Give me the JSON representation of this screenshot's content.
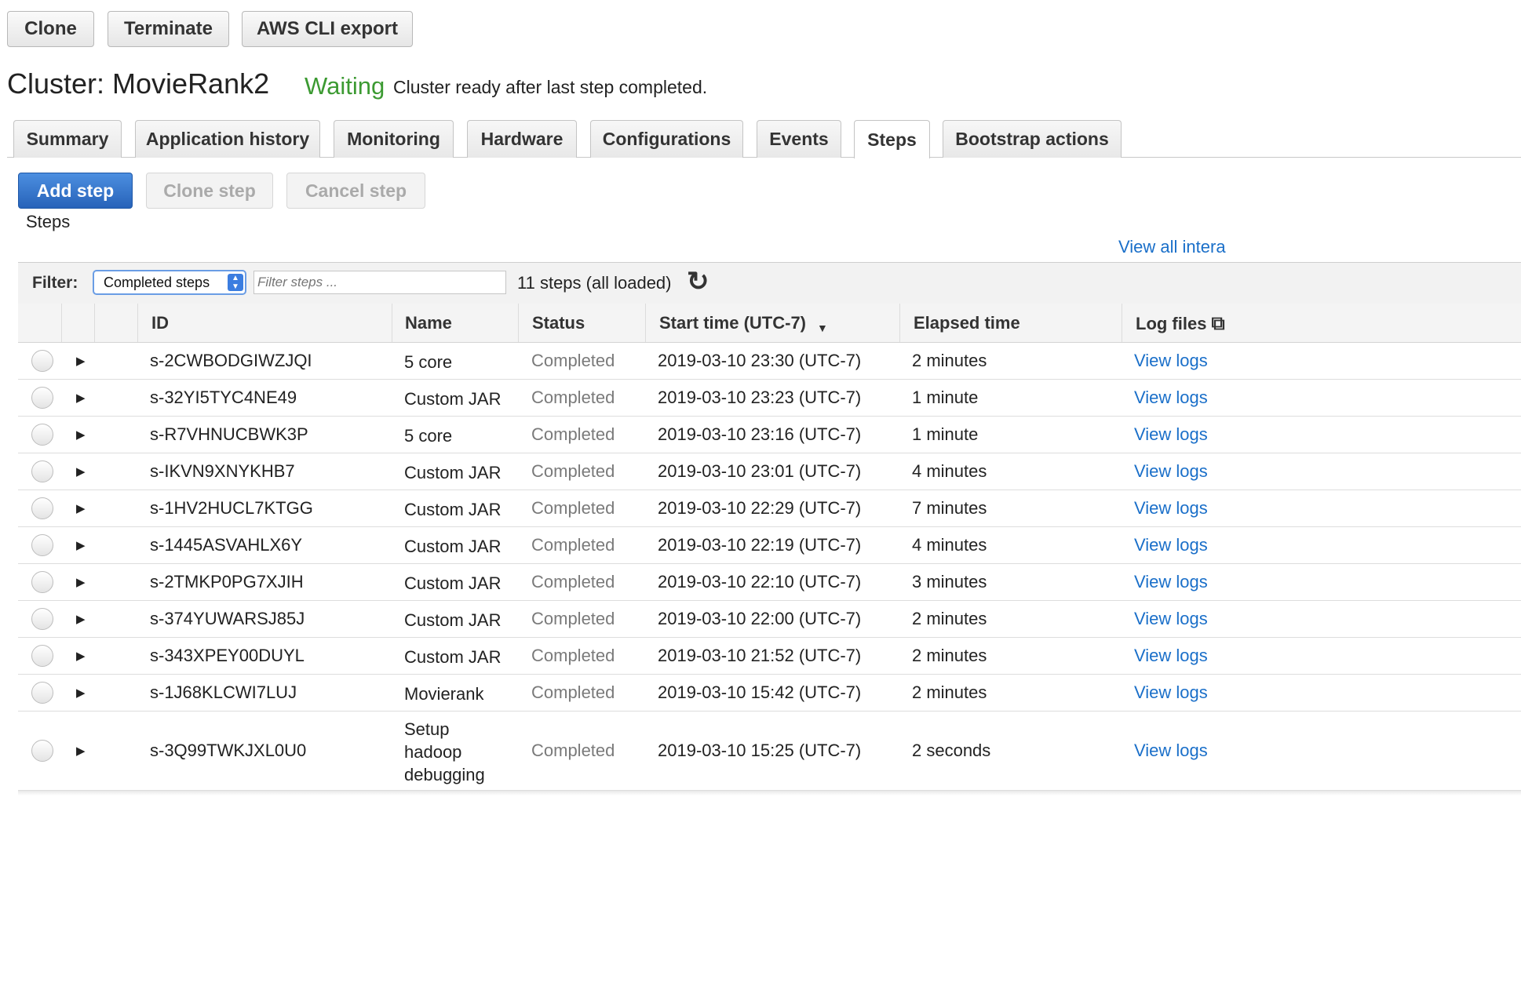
{
  "toolbar": {
    "clone": "Clone",
    "terminate": "Terminate",
    "cli_export": "AWS CLI export"
  },
  "cluster": {
    "title": "Cluster: MovieRank2",
    "state": "Waiting",
    "state_message": "Cluster ready after last step completed.",
    "state_color": "#3c9a32"
  },
  "tabs": [
    {
      "label": "Summary"
    },
    {
      "label": "Application history"
    },
    {
      "label": "Monitoring"
    },
    {
      "label": "Hardware"
    },
    {
      "label": "Configurations"
    },
    {
      "label": "Events"
    },
    {
      "label": "Steps",
      "active": true
    },
    {
      "label": "Bootstrap actions"
    }
  ],
  "step_actions": {
    "add": "Add step",
    "clone": "Clone step",
    "cancel": "Cancel step"
  },
  "steps_section_label": "Steps",
  "view_all_link": "View all intera",
  "filter": {
    "label": "Filter:",
    "selected": "Completed steps",
    "placeholder": "Filter steps ...",
    "count": "11 steps (all loaded)"
  },
  "columns": {
    "id": "ID",
    "name": "Name",
    "status": "Status",
    "start_time": "Start time (UTC-7)",
    "elapsed": "Elapsed time",
    "log_files": "Log files"
  },
  "icons": {
    "refresh": "refresh-icon",
    "sort": "sort-desc-icon",
    "external": "external-link-icon",
    "expand": "expand-arrow-icon"
  },
  "colors": {
    "link": "#1a6fc9",
    "primary_button": "#2f6fc7"
  },
  "steps": [
    {
      "id": "s-2CWBODGIWZJQI",
      "name": "5 core",
      "status": "Completed",
      "start": "2019-03-10 23:30 (UTC-7)",
      "elapsed": "2 minutes",
      "logs": "View logs"
    },
    {
      "id": "s-32YI5TYC4NE49",
      "name": "Custom JAR",
      "status": "Completed",
      "start": "2019-03-10 23:23 (UTC-7)",
      "elapsed": "1 minute",
      "logs": "View logs"
    },
    {
      "id": "s-R7VHNUCBWK3P",
      "name": "5 core",
      "status": "Completed",
      "start": "2019-03-10 23:16 (UTC-7)",
      "elapsed": "1 minute",
      "logs": "View logs"
    },
    {
      "id": "s-IKVN9XNYKHB7",
      "name": "Custom JAR",
      "status": "Completed",
      "start": "2019-03-10 23:01 (UTC-7)",
      "elapsed": "4 minutes",
      "logs": "View logs"
    },
    {
      "id": "s-1HV2HUCL7KTGG",
      "name": "Custom JAR",
      "status": "Completed",
      "start": "2019-03-10 22:29 (UTC-7)",
      "elapsed": "7 minutes",
      "logs": "View logs"
    },
    {
      "id": "s-1445ASVAHLX6Y",
      "name": "Custom JAR",
      "status": "Completed",
      "start": "2019-03-10 22:19 (UTC-7)",
      "elapsed": "4 minutes",
      "logs": "View logs"
    },
    {
      "id": "s-2TMKP0PG7XJIH",
      "name": "Custom JAR",
      "status": "Completed",
      "start": "2019-03-10 22:10 (UTC-7)",
      "elapsed": "3 minutes",
      "logs": "View logs"
    },
    {
      "id": "s-374YUWARSJ85J",
      "name": "Custom JAR",
      "status": "Completed",
      "start": "2019-03-10 22:00 (UTC-7)",
      "elapsed": "2 minutes",
      "logs": "View logs"
    },
    {
      "id": "s-343XPEY00DUYL",
      "name": "Custom JAR",
      "status": "Completed",
      "start": "2019-03-10 21:52 (UTC-7)",
      "elapsed": "2 minutes",
      "logs": "View logs"
    },
    {
      "id": "s-1J68KLCWI7LUJ",
      "name": "Movierank",
      "status": "Completed",
      "start": "2019-03-10 15:42 (UTC-7)",
      "elapsed": "2 minutes",
      "logs": "View logs"
    },
    {
      "id": "s-3Q99TWKJXL0U0",
      "name": "Setup\nhadoop\ndebugging",
      "status": "Completed",
      "start": "2019-03-10 15:25 (UTC-7)",
      "elapsed": "2 seconds",
      "logs": "View logs"
    }
  ]
}
